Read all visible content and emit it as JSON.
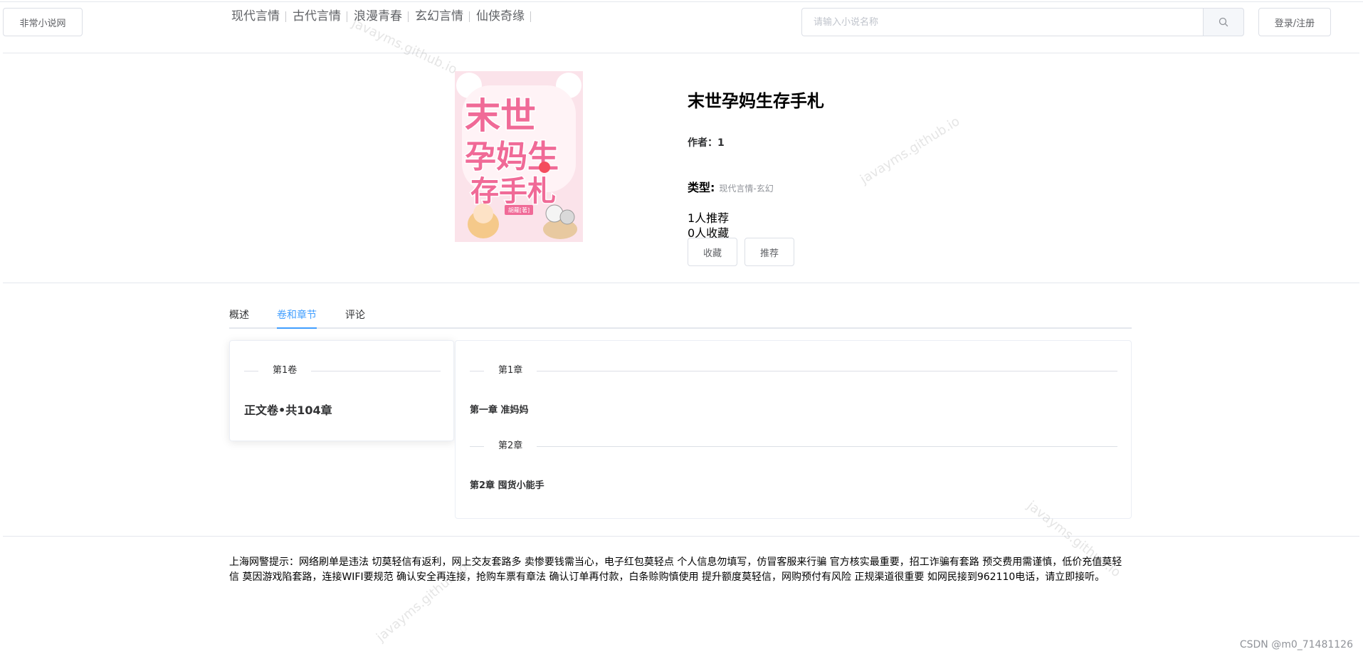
{
  "header": {
    "site_name": "非常小说网",
    "nav": [
      "现代言情",
      "古代言情",
      "浪漫青春",
      "玄幻言情",
      "仙侠奇缘"
    ],
    "search_placeholder": "请输入小说名称",
    "login_label": "登录/注册"
  },
  "book": {
    "title": "末世孕妈生存手札",
    "author_label": "作者：",
    "author": "1",
    "type_label": "类型:",
    "type_value": "现代言情-玄幻",
    "recommend_count": "1人推荐",
    "favorite_count": "0人收藏",
    "favorite_btn": "收藏",
    "recommend_btn": "推荐",
    "cover": {
      "title_text": "末世孕妈生存手札",
      "author_tag": "胡蘿[著]",
      "colors": {
        "background": "#fbe3ea",
        "title": "#f06a97",
        "title_stroke": "#ffffff"
      }
    }
  },
  "tabs": [
    {
      "label": "概述",
      "active": false
    },
    {
      "label": "卷和章节",
      "active": true
    },
    {
      "label": "评论",
      "active": false
    }
  ],
  "volumes": {
    "divider_label": "第1卷",
    "summary": "正文卷•共104章"
  },
  "chapters": [
    {
      "divider": "第1章",
      "title": "第一章 准妈妈"
    },
    {
      "divider": "第2章",
      "title": "第2章 囤货小能手"
    }
  ],
  "notice": "上海网警提示：网络刷单是违法 切莫轻信有返利，网上交友套路多 卖惨要钱需当心，电子红包莫轻点 个人信息勿填写，仿冒客服来行骗 官方核实最重要，招工诈骗有套路 预交费用需谨慎，低价充值莫轻信 莫因游戏陷套路，连接WIFI要规范 确认安全再连接，抢购车票有章法 确认订单再付款，白条赊购慎使用 提升额度莫轻信，网购预付有风险 正规渠道很重要 如网民接到962110电话，请立即接听。",
  "watermark": "javayms.github.io",
  "credit": "CSDN @m0_71481126",
  "colors": {
    "accent": "#409eff",
    "border": "#dcdfe6",
    "muted": "#909399"
  }
}
